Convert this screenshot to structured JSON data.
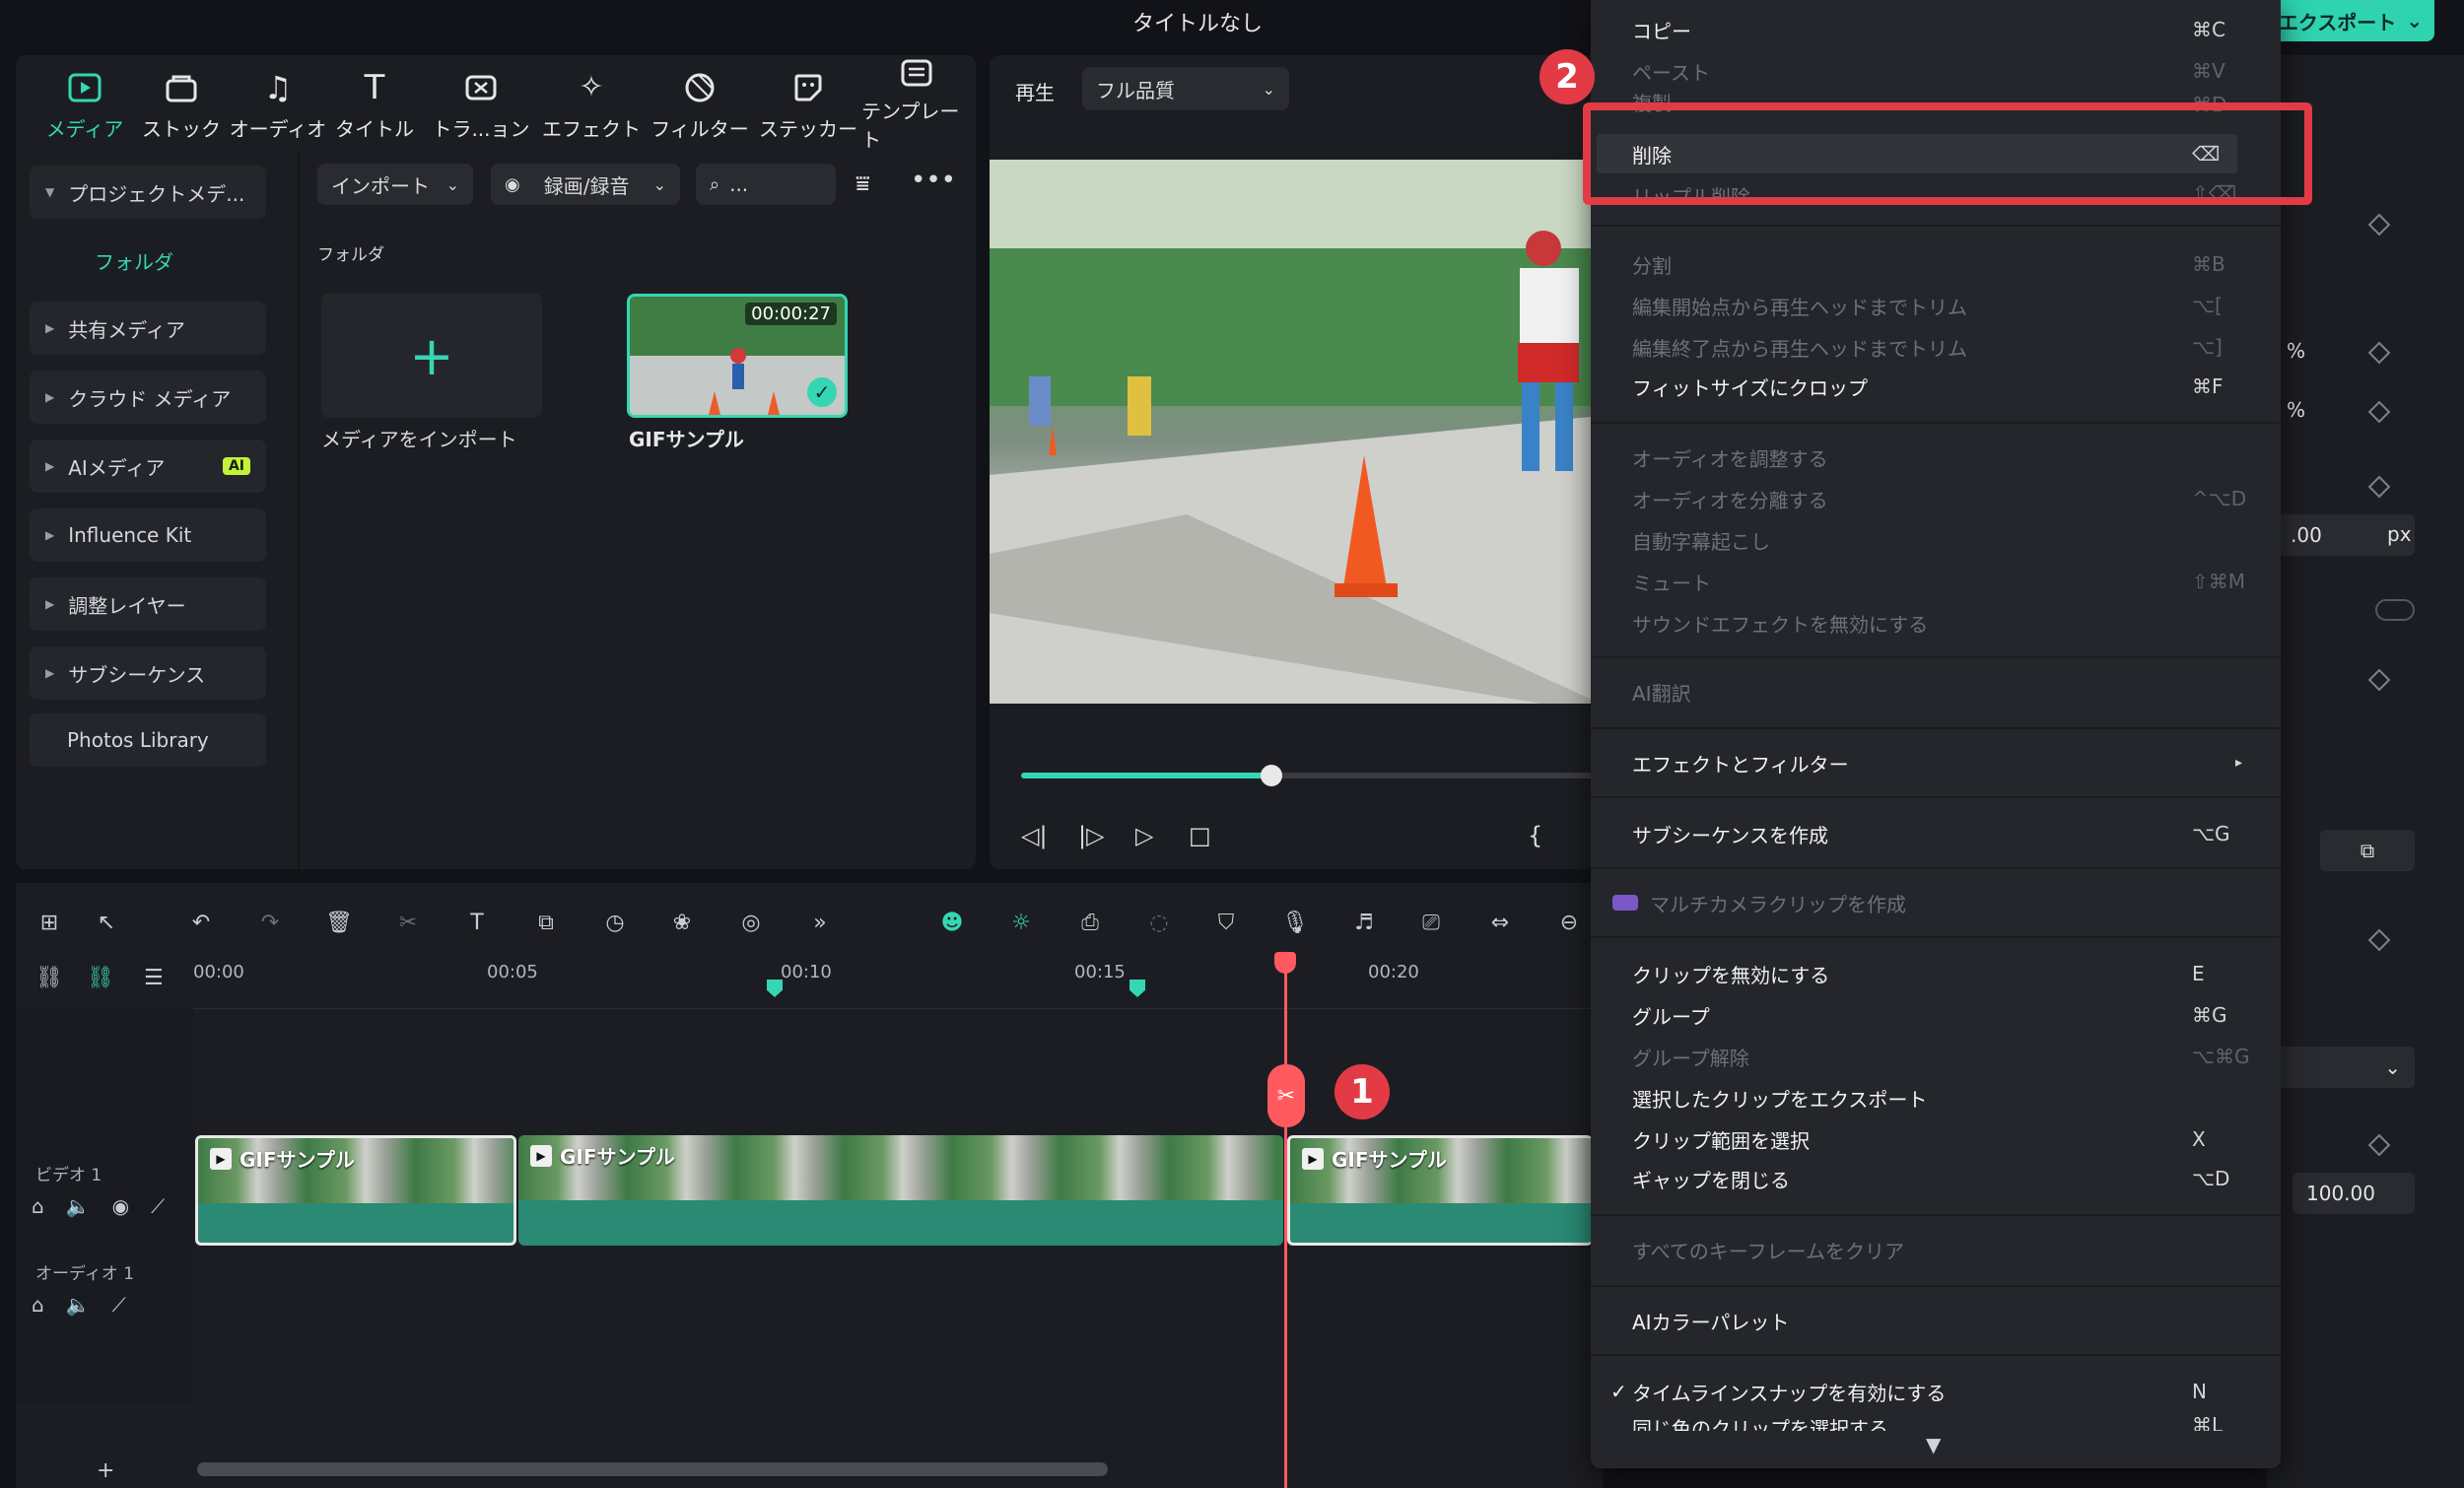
{
  "window": {
    "title": "タイトルなし",
    "export_label": "エクスポート"
  },
  "media_toolbar": {
    "tabs": [
      {
        "label": "メディア",
        "icon": "media-icon"
      },
      {
        "label": "ストック",
        "icon": "stock-icon"
      },
      {
        "label": "オーディオ",
        "icon": "music-note-icon"
      },
      {
        "label": "タイトル",
        "icon": "title-t-icon"
      },
      {
        "label": "トラ...ョン",
        "icon": "transition-icon"
      },
      {
        "label": "エフェクト",
        "icon": "effects-icon"
      },
      {
        "label": "フィルター",
        "icon": "filter-icon"
      },
      {
        "label": "ステッカー",
        "icon": "sticker-icon"
      },
      {
        "label": "テンプレート",
        "icon": "template-icon"
      }
    ]
  },
  "media_nav": {
    "project_media": "プロジェクトメデ...",
    "folder": "フォルダ",
    "shared_media": "共有メディア",
    "cloud_media": "クラウド メディア",
    "ai_media": "AIメディア",
    "ai_badge": "AI",
    "influence_kit": "Influence Kit",
    "adjustment_layer": "調整レイヤー",
    "subsequence": "サブシーケンス",
    "photos_library": "Photos Library"
  },
  "media_browser": {
    "import_btn": "インポート",
    "record_btn": "録画/録音",
    "search_placeholder": "...",
    "folder_heading": "フォルダ",
    "import_tile_label": "メディアをインポート",
    "gif_label": "GIFサンプル",
    "gif_duration": "00:00:27"
  },
  "player": {
    "play_label": "再生",
    "quality": "フル品質",
    "progress": 0.43
  },
  "timeline": {
    "ruler": [
      "00:00",
      "00:05",
      "00:10",
      "00:15",
      "00:20"
    ],
    "video_track": "ビデオ 1",
    "audio_track": "オーディオ 1",
    "clip_label": "GIFサンプル",
    "add_track": "+"
  },
  "steps": {
    "step1": "1",
    "step2": "2"
  },
  "props": {
    "percent1": "%",
    "percent2": "%",
    "px_value": ".00",
    "px_unit": "px",
    "value_100": "100.00"
  },
  "context_menu": {
    "items": [
      {
        "label": "コピー",
        "shortcut": "⌘C",
        "enabled": true
      },
      {
        "label": "ペースト",
        "shortcut": "⌘V",
        "enabled": false
      },
      {
        "label": "複製",
        "shortcut": "⌘D",
        "enabled": false
      },
      {
        "label": "削除",
        "shortcut": "⌫",
        "enabled": true
      },
      {
        "label": "リップル削除",
        "shortcut": "⇧⌫",
        "enabled": false
      },
      {
        "label": "分割",
        "shortcut": "⌘B",
        "enabled": false
      },
      {
        "label": "編集開始点から再生ヘッドまでトリム",
        "shortcut": "⌥[",
        "enabled": false
      },
      {
        "label": "編集終了点から再生ヘッドまでトリム",
        "shortcut": "⌥]",
        "enabled": false
      },
      {
        "label": "フィットサイズにクロップ",
        "shortcut": "⌘F",
        "enabled": true
      },
      {
        "label": "オーディオを調整する",
        "shortcut": "",
        "enabled": false
      },
      {
        "label": "オーディオを分離する",
        "shortcut": "^⌥D",
        "enabled": false
      },
      {
        "label": "自動字幕起こし",
        "shortcut": "",
        "enabled": false
      },
      {
        "label": "ミュート",
        "shortcut": "⇧⌘M",
        "enabled": false
      },
      {
        "label": "サウンドエフェクトを無効にする",
        "shortcut": "",
        "enabled": false
      },
      {
        "label": "AI翻訳",
        "shortcut": "",
        "enabled": false
      },
      {
        "label": "エフェクトとフィルター",
        "shortcut": "▸",
        "enabled": true
      },
      {
        "label": "サブシーケンスを作成",
        "shortcut": "⌥G",
        "enabled": true
      },
      {
        "label": "マルチカメラクリップを作成",
        "shortcut": "",
        "enabled": false
      },
      {
        "label": "クリップを無効にする",
        "shortcut": "E",
        "enabled": true
      },
      {
        "label": "グループ",
        "shortcut": "⌘G",
        "enabled": true
      },
      {
        "label": "グループ解除",
        "shortcut": "⌥⌘G",
        "enabled": false
      },
      {
        "label": "選択したクリップをエクスポート",
        "shortcut": "",
        "enabled": true
      },
      {
        "label": "クリップ範囲を選択",
        "shortcut": "X",
        "enabled": true
      },
      {
        "label": "ギャップを閉じる",
        "shortcut": "⌥D",
        "enabled": true
      },
      {
        "label": "すべてのキーフレームをクリア",
        "shortcut": "",
        "enabled": false
      },
      {
        "label": "AIカラーパレット",
        "shortcut": "",
        "enabled": true
      },
      {
        "label": "タイムラインスナップを有効にする",
        "shortcut": "N",
        "enabled": true,
        "checked": true
      },
      {
        "label": "同じ色のクリップを選択する",
        "shortcut": "⌘L",
        "enabled": true
      }
    ],
    "more_arrow": "▼"
  },
  "colors": {
    "accent": "#35d6b3",
    "danger": "#e23b46",
    "playhead": "#ff5a5f"
  }
}
